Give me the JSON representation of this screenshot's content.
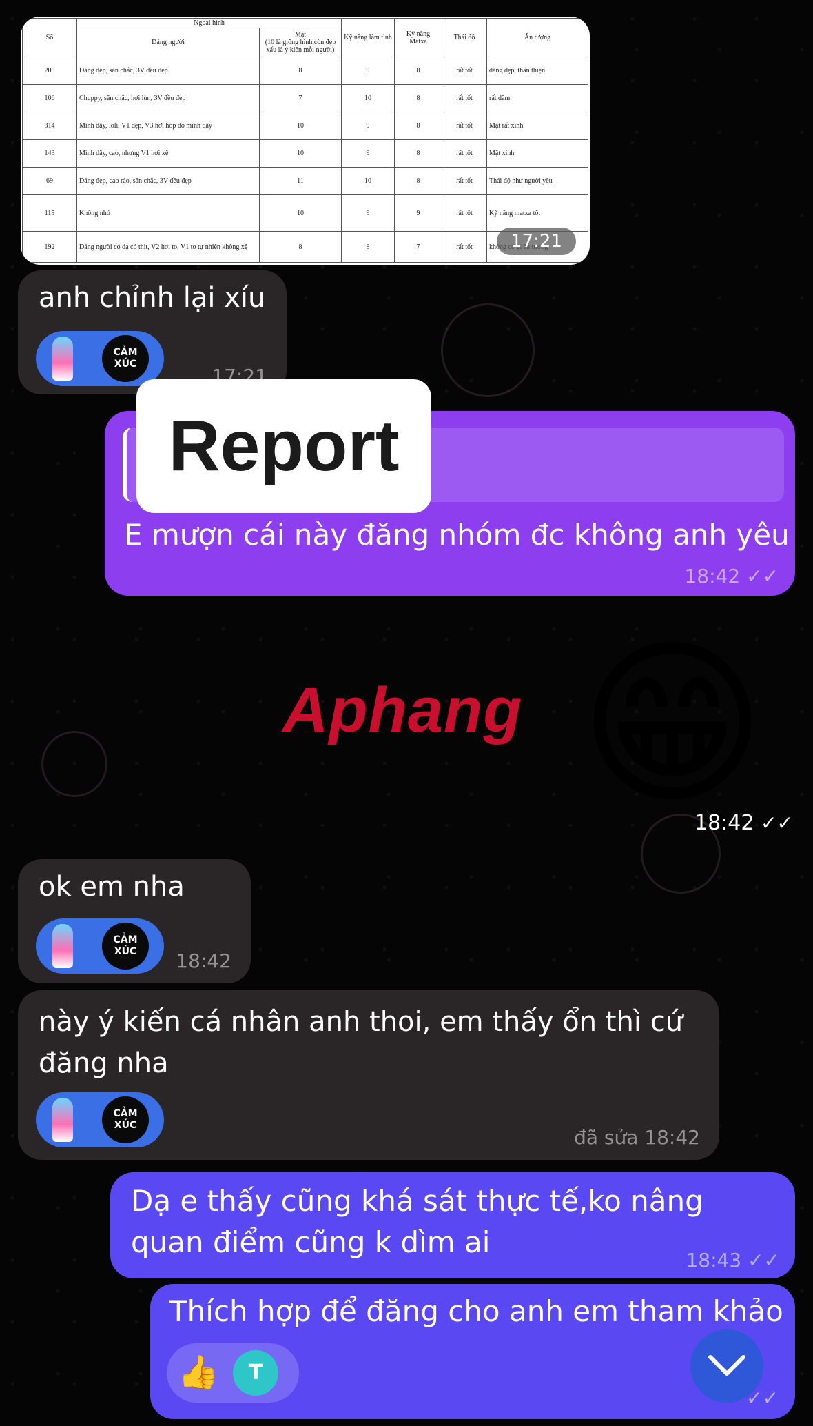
{
  "table": {
    "header_group": "Ngoại hình",
    "columns": [
      "Số",
      "Dáng người",
      "Mặt",
      "(10 là giống hình,còn đẹp",
      "xấu là ý kiến mỗi người)",
      "Kỹ năng làm tình",
      "Kỹ năng Matxa",
      "Thái độ",
      "Ấn tượng"
    ],
    "rows": [
      [
        "200",
        "Dáng đẹp, săn chắc, 3V đều đẹp",
        "8",
        "9",
        "8",
        "rất tốt",
        "dáng đẹp, thân thiện"
      ],
      [
        "106",
        "Chuppy, săn chắc, hơi lùn, 3V đều đẹp",
        "7",
        "10",
        "8",
        "rất tốt",
        "rất dâm"
      ],
      [
        "314",
        "Mình dây, loli, V1 đẹp, V3 hơi hóp do mình dây",
        "10",
        "9",
        "8",
        "rất tốt",
        "Mặt rất xinh"
      ],
      [
        "143",
        "Mình dây, cao, nhưng V1 hơi xệ",
        "10",
        "9",
        "8",
        "rất tốt",
        "Mặt xinh"
      ],
      [
        "69",
        "Dáng đẹp, cao ráo, săn chắc, 3V đều đẹp",
        "11",
        "10",
        "8",
        "rất tốt",
        "Thái độ như người yêu"
      ],
      [
        "115",
        "Không nhớ",
        "10",
        "9",
        "9",
        "rất tốt",
        "Kỹ năng matxa tốt"
      ],
      [
        "192",
        "Dáng người có da có thịt, V2 hơi to, V1 to tự nhiên không xệ",
        "8",
        "8",
        "7",
        "rất tốt",
        "không có gì ấn tượng"
      ]
    ],
    "time": "17:21"
  },
  "messages": {
    "m1": {
      "text": "anh chỉnh lại xíu",
      "time": "17:21"
    },
    "m2": {
      "reply_title": "Report",
      "text": "E mượn cái này đăng nhóm đc không anh yêu",
      "time": "18:42"
    },
    "m3": {
      "emoji": "😁",
      "time": "18:42"
    },
    "m4": {
      "text": "ok em nha",
      "time": "18:42"
    },
    "m5": {
      "text": "này ý kiến cá nhân anh thoi, em thấy ổn thì cứ đăng nha",
      "time": "đã sửa 18:42"
    },
    "m6": {
      "text": "Dạ e thấy cũng khá sát thực tế,ko nâng quan điểm cũng k dìm ai",
      "time": "18:43"
    },
    "m7": {
      "text": "Thích hợp để đăng cho anh em tham khảo",
      "reaction_emoji": "👍",
      "reaction_user": "T"
    }
  },
  "reaction_badge": {
    "line1": "CẢM",
    "line2": "XÚC"
  },
  "watermark": "Aphang",
  "checkmark": "✓✓"
}
